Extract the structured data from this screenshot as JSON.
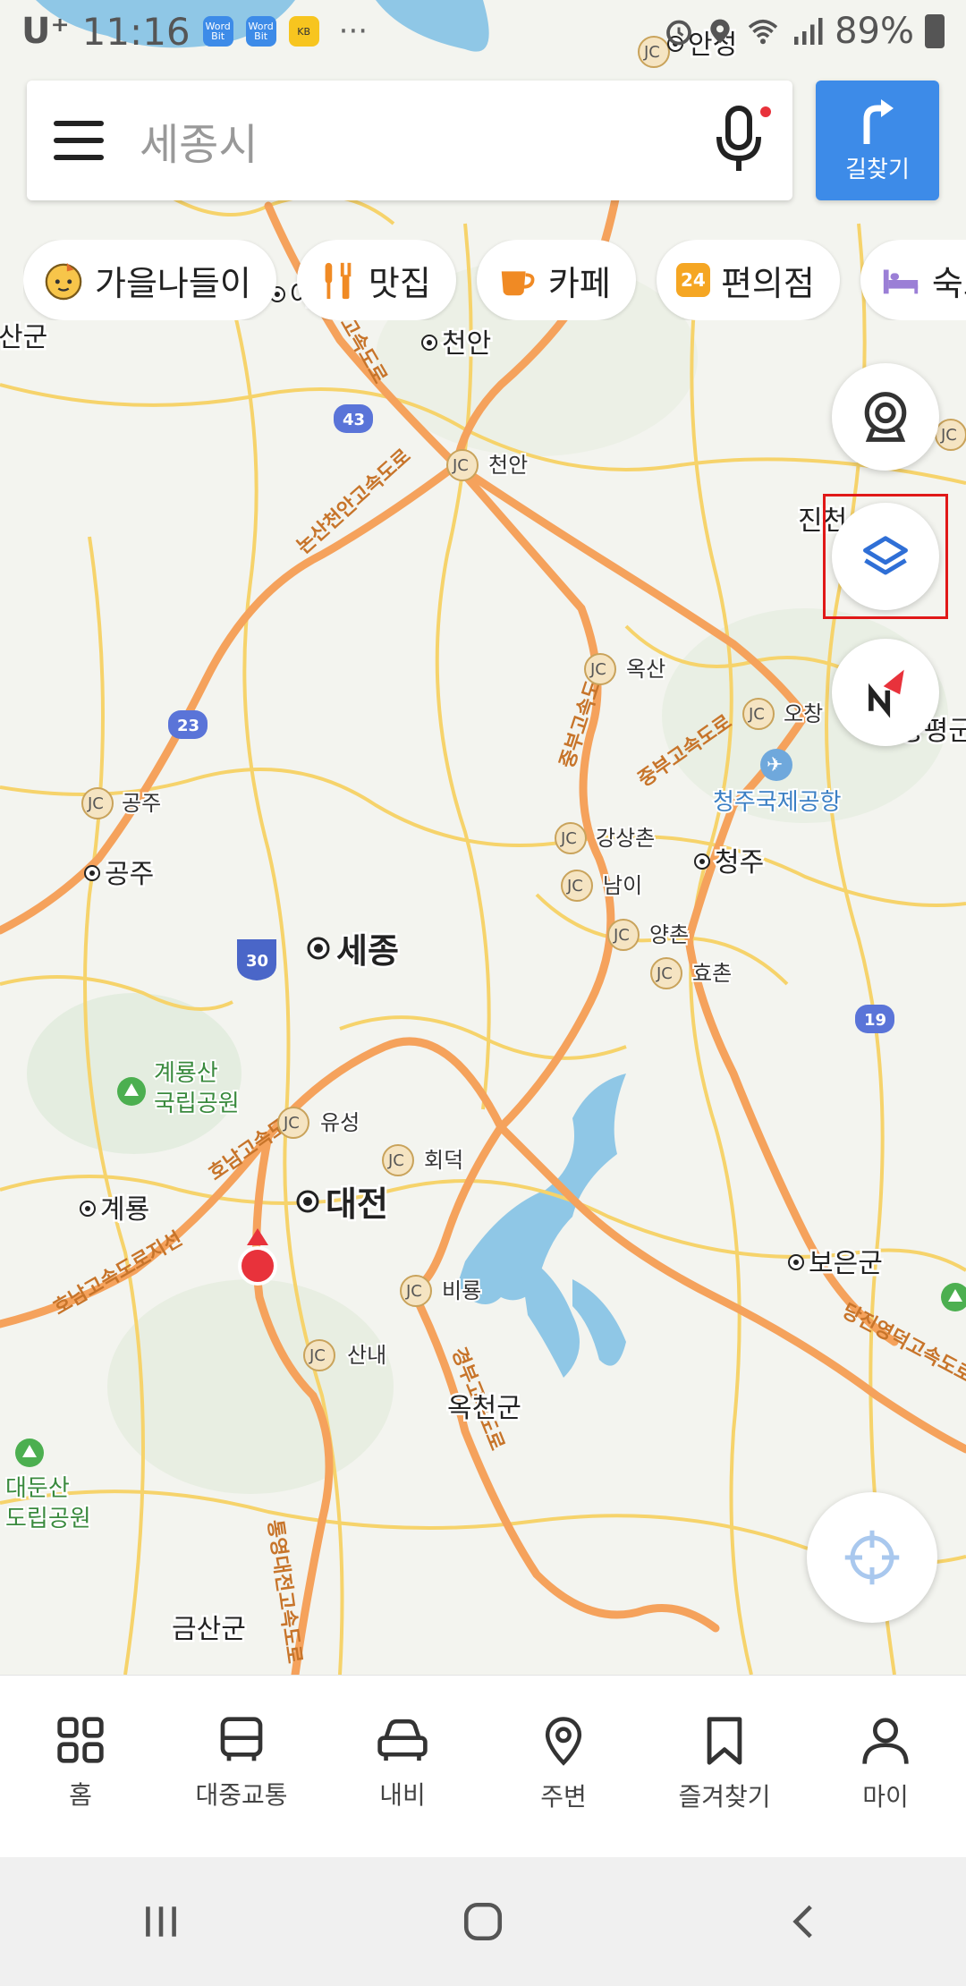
{
  "status_bar": {
    "carrier": "U⁺",
    "time": "11:16",
    "app_icons": [
      "Word Bit",
      "Word Bit",
      "KB"
    ],
    "more": "···",
    "battery": "89%"
  },
  "search": {
    "placeholder": "세종시"
  },
  "route_button": {
    "label": "길찾기"
  },
  "chips": [
    {
      "label": "가을나들이",
      "icon": "autumn-face-icon"
    },
    {
      "label": "맛집",
      "icon": "restaurant-icon"
    },
    {
      "label": "카페",
      "icon": "cafe-icon"
    },
    {
      "label": "편의점",
      "icon": "convenience-store-icon",
      "badge": "24"
    },
    {
      "label": "숙소",
      "icon": "lodging-icon"
    }
  ],
  "map": {
    "cities": [
      {
        "name": "세종",
        "major": true
      },
      {
        "name": "대전",
        "major": true
      },
      {
        "name": "천안"
      },
      {
        "name": "청주"
      },
      {
        "name": "공주"
      },
      {
        "name": "계룡"
      },
      {
        "name": "보은군"
      },
      {
        "name": "옥천군"
      },
      {
        "name": "금산군"
      },
      {
        "name": "안성"
      },
      {
        "name": "진천"
      },
      {
        "name": "증평군"
      },
      {
        "name": "아산"
      },
      {
        "name": "산군"
      }
    ],
    "junctions": [
      "안성",
      "천안",
      "옥산",
      "오창",
      "공주",
      "강상촌",
      "남이",
      "양촌",
      "효촌",
      "유성",
      "회덕",
      "비룡",
      "산내"
    ],
    "jc_badge": "JC",
    "parks": [
      "계룡산 국립공원",
      "대둔산 도립공원"
    ],
    "park_lines": [
      [
        "계룡산",
        "국립공원"
      ],
      [
        "대둔산",
        "도립공원"
      ]
    ],
    "airport": "청주국제공항",
    "route_shields": [
      "43",
      "23",
      "30",
      "19"
    ],
    "highways": [
      "논산천안고속도로",
      "중부고속도로",
      "호남고속도로",
      "당진영덕고속도로",
      "경부고속도로",
      "통영대전고속도로",
      "호남고속도로지선"
    ]
  },
  "bottom_nav": [
    {
      "label": "홈",
      "icon": "home-grid-icon"
    },
    {
      "label": "대중교통",
      "icon": "bus-icon"
    },
    {
      "label": "내비",
      "icon": "car-icon"
    },
    {
      "label": "주변",
      "icon": "location-pin-icon"
    },
    {
      "label": "즐겨찾기",
      "icon": "bookmark-icon"
    },
    {
      "label": "마이",
      "icon": "person-icon"
    }
  ],
  "colors": {
    "accent": "#3d8be8",
    "map_bg": "#f3f4ef",
    "road_major": "#f5a25c",
    "road_minor": "#f6d36b",
    "water": "#8fc7e6",
    "marker": "#e8323b"
  }
}
